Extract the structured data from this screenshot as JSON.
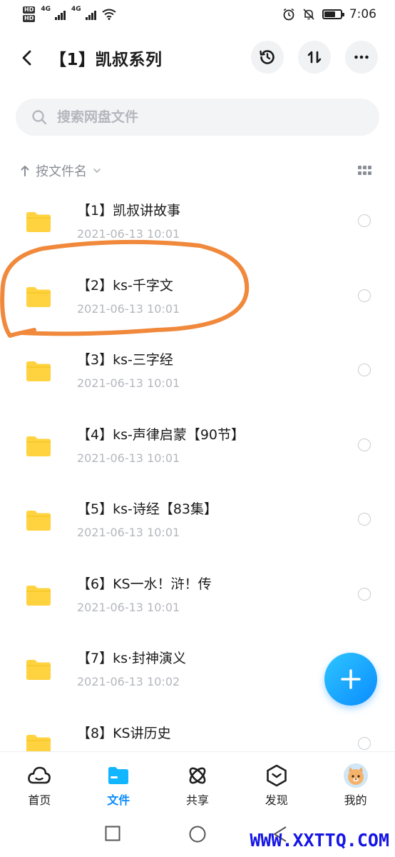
{
  "status_bar": {
    "hd1": "HD",
    "hd2": "HD",
    "net1": "4G",
    "net2": "4G",
    "time": "7:06",
    "battery_level": 0.7
  },
  "header": {
    "title": "【1】凯叔系列",
    "icons": [
      "chevron-left-icon",
      "history-icon",
      "sort-arrows-icon",
      "more-icon"
    ]
  },
  "search": {
    "placeholder": "搜索网盘文件"
  },
  "sort": {
    "label": "按文件名"
  },
  "files": [
    {
      "name": "【1】凯叔讲故事",
      "date": "2021-06-13  10:01"
    },
    {
      "name": "【2】ks-千字文",
      "date": "2021-06-13  10:01"
    },
    {
      "name": "【3】ks-三字经",
      "date": "2021-06-13  10:01"
    },
    {
      "name": "【4】ks-声律启蒙【90节】",
      "date": "2021-06-13  10:01"
    },
    {
      "name": "【5】ks-诗经【83集】",
      "date": "2021-06-13  10:01"
    },
    {
      "name": "【6】KS一水！浒！传",
      "date": "2021-06-13  10:01"
    },
    {
      "name": "【7】ks·封神演义",
      "date": "2021-06-13  10:02"
    },
    {
      "name": "【8】KS讲历史",
      "date": ""
    }
  ],
  "nav": {
    "items": [
      {
        "label": "首页"
      },
      {
        "label": "文件"
      },
      {
        "label": "共享"
      },
      {
        "label": "发现"
      },
      {
        "label": "我的"
      }
    ]
  },
  "colors": {
    "accent": "#0a8cff",
    "folder": "#ffd23f",
    "annotation": "#f0893c",
    "watermark": "#1515e6"
  },
  "watermark": "WWW.XXTTQ.COM"
}
